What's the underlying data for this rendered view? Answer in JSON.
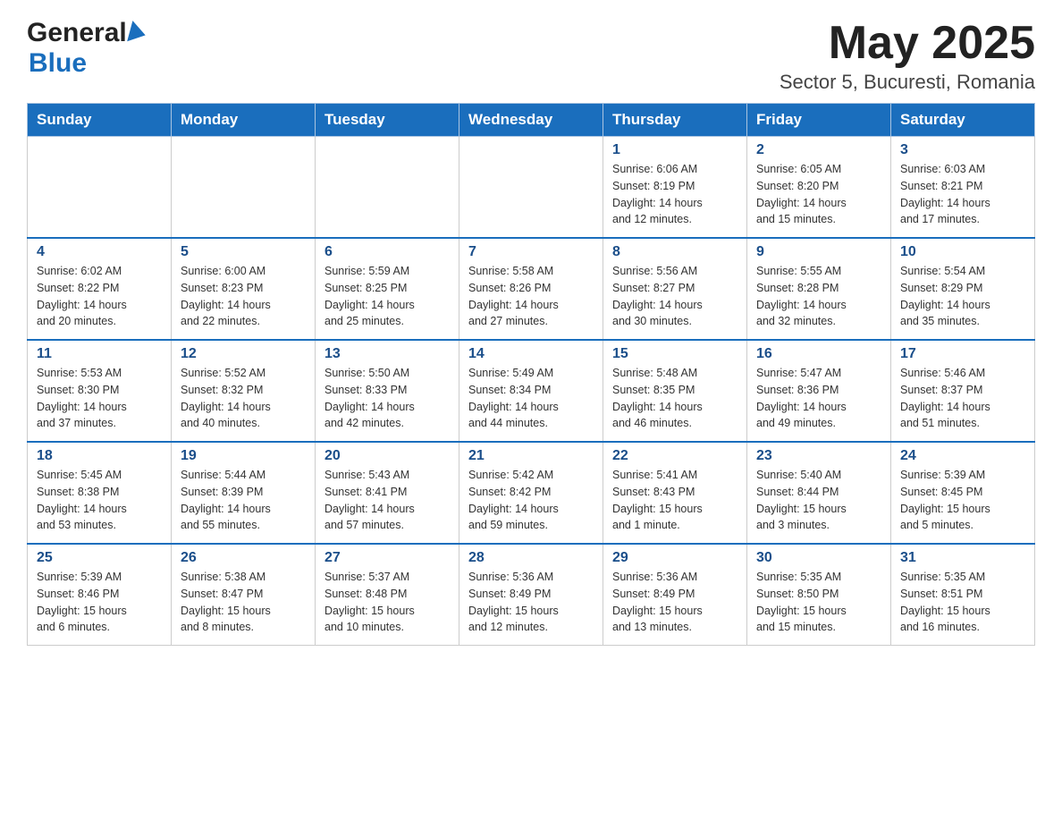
{
  "header": {
    "logo_general": "General",
    "logo_blue": "Blue",
    "month_title": "May 2025",
    "location": "Sector 5, Bucuresti, Romania"
  },
  "days_of_week": [
    "Sunday",
    "Monday",
    "Tuesday",
    "Wednesday",
    "Thursday",
    "Friday",
    "Saturday"
  ],
  "weeks": [
    [
      {
        "day": "",
        "info": ""
      },
      {
        "day": "",
        "info": ""
      },
      {
        "day": "",
        "info": ""
      },
      {
        "day": "",
        "info": ""
      },
      {
        "day": "1",
        "info": "Sunrise: 6:06 AM\nSunset: 8:19 PM\nDaylight: 14 hours\nand 12 minutes."
      },
      {
        "day": "2",
        "info": "Sunrise: 6:05 AM\nSunset: 8:20 PM\nDaylight: 14 hours\nand 15 minutes."
      },
      {
        "day": "3",
        "info": "Sunrise: 6:03 AM\nSunset: 8:21 PM\nDaylight: 14 hours\nand 17 minutes."
      }
    ],
    [
      {
        "day": "4",
        "info": "Sunrise: 6:02 AM\nSunset: 8:22 PM\nDaylight: 14 hours\nand 20 minutes."
      },
      {
        "day": "5",
        "info": "Sunrise: 6:00 AM\nSunset: 8:23 PM\nDaylight: 14 hours\nand 22 minutes."
      },
      {
        "day": "6",
        "info": "Sunrise: 5:59 AM\nSunset: 8:25 PM\nDaylight: 14 hours\nand 25 minutes."
      },
      {
        "day": "7",
        "info": "Sunrise: 5:58 AM\nSunset: 8:26 PM\nDaylight: 14 hours\nand 27 minutes."
      },
      {
        "day": "8",
        "info": "Sunrise: 5:56 AM\nSunset: 8:27 PM\nDaylight: 14 hours\nand 30 minutes."
      },
      {
        "day": "9",
        "info": "Sunrise: 5:55 AM\nSunset: 8:28 PM\nDaylight: 14 hours\nand 32 minutes."
      },
      {
        "day": "10",
        "info": "Sunrise: 5:54 AM\nSunset: 8:29 PM\nDaylight: 14 hours\nand 35 minutes."
      }
    ],
    [
      {
        "day": "11",
        "info": "Sunrise: 5:53 AM\nSunset: 8:30 PM\nDaylight: 14 hours\nand 37 minutes."
      },
      {
        "day": "12",
        "info": "Sunrise: 5:52 AM\nSunset: 8:32 PM\nDaylight: 14 hours\nand 40 minutes."
      },
      {
        "day": "13",
        "info": "Sunrise: 5:50 AM\nSunset: 8:33 PM\nDaylight: 14 hours\nand 42 minutes."
      },
      {
        "day": "14",
        "info": "Sunrise: 5:49 AM\nSunset: 8:34 PM\nDaylight: 14 hours\nand 44 minutes."
      },
      {
        "day": "15",
        "info": "Sunrise: 5:48 AM\nSunset: 8:35 PM\nDaylight: 14 hours\nand 46 minutes."
      },
      {
        "day": "16",
        "info": "Sunrise: 5:47 AM\nSunset: 8:36 PM\nDaylight: 14 hours\nand 49 minutes."
      },
      {
        "day": "17",
        "info": "Sunrise: 5:46 AM\nSunset: 8:37 PM\nDaylight: 14 hours\nand 51 minutes."
      }
    ],
    [
      {
        "day": "18",
        "info": "Sunrise: 5:45 AM\nSunset: 8:38 PM\nDaylight: 14 hours\nand 53 minutes."
      },
      {
        "day": "19",
        "info": "Sunrise: 5:44 AM\nSunset: 8:39 PM\nDaylight: 14 hours\nand 55 minutes."
      },
      {
        "day": "20",
        "info": "Sunrise: 5:43 AM\nSunset: 8:41 PM\nDaylight: 14 hours\nand 57 minutes."
      },
      {
        "day": "21",
        "info": "Sunrise: 5:42 AM\nSunset: 8:42 PM\nDaylight: 14 hours\nand 59 minutes."
      },
      {
        "day": "22",
        "info": "Sunrise: 5:41 AM\nSunset: 8:43 PM\nDaylight: 15 hours\nand 1 minute."
      },
      {
        "day": "23",
        "info": "Sunrise: 5:40 AM\nSunset: 8:44 PM\nDaylight: 15 hours\nand 3 minutes."
      },
      {
        "day": "24",
        "info": "Sunrise: 5:39 AM\nSunset: 8:45 PM\nDaylight: 15 hours\nand 5 minutes."
      }
    ],
    [
      {
        "day": "25",
        "info": "Sunrise: 5:39 AM\nSunset: 8:46 PM\nDaylight: 15 hours\nand 6 minutes."
      },
      {
        "day": "26",
        "info": "Sunrise: 5:38 AM\nSunset: 8:47 PM\nDaylight: 15 hours\nand 8 minutes."
      },
      {
        "day": "27",
        "info": "Sunrise: 5:37 AM\nSunset: 8:48 PM\nDaylight: 15 hours\nand 10 minutes."
      },
      {
        "day": "28",
        "info": "Sunrise: 5:36 AM\nSunset: 8:49 PM\nDaylight: 15 hours\nand 12 minutes."
      },
      {
        "day": "29",
        "info": "Sunrise: 5:36 AM\nSunset: 8:49 PM\nDaylight: 15 hours\nand 13 minutes."
      },
      {
        "day": "30",
        "info": "Sunrise: 5:35 AM\nSunset: 8:50 PM\nDaylight: 15 hours\nand 15 minutes."
      },
      {
        "day": "31",
        "info": "Sunrise: 5:35 AM\nSunset: 8:51 PM\nDaylight: 15 hours\nand 16 minutes."
      }
    ]
  ]
}
